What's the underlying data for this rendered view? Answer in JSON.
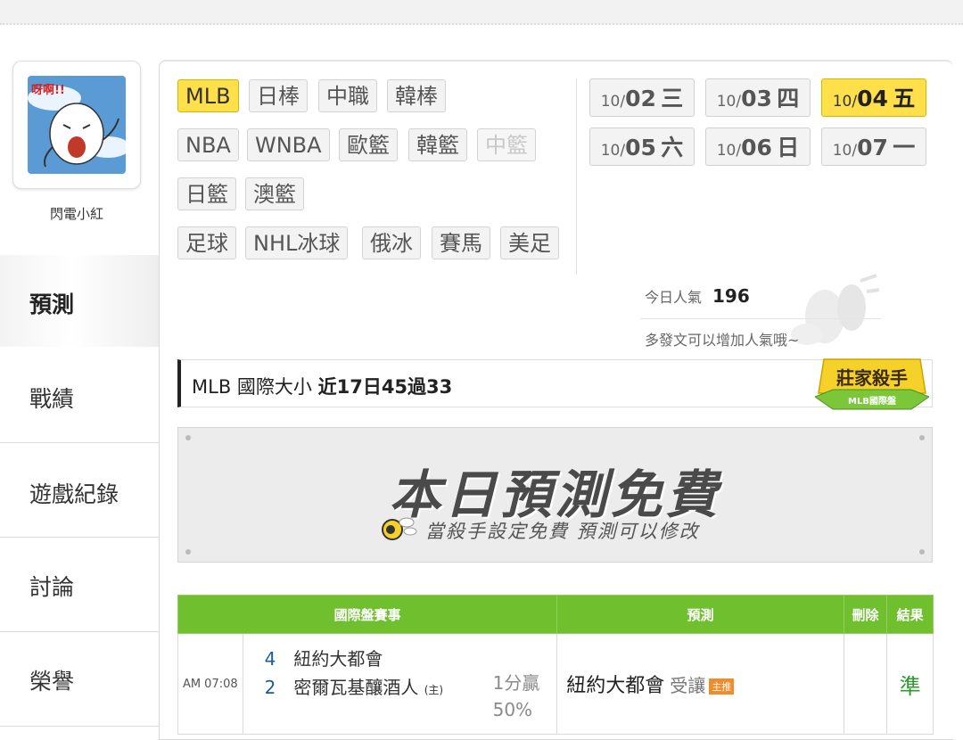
{
  "user": {
    "name": "閃電小紅",
    "avatar_text": "呀啊!!"
  },
  "nav": [
    {
      "label": "預測",
      "active": true
    },
    {
      "label": "戰績"
    },
    {
      "label": "遊戲紀錄"
    },
    {
      "label": "討論"
    },
    {
      "label": "榮譽"
    }
  ],
  "leagues": [
    {
      "label": "MLB",
      "active": true
    },
    {
      "label": "日棒"
    },
    {
      "label": "中職"
    },
    {
      "label": "韓棒"
    },
    {
      "label": "NBA"
    },
    {
      "label": "WNBA"
    },
    {
      "label": "歐籃"
    },
    {
      "label": "韓籃"
    },
    {
      "label": "中籃",
      "disabled": true
    },
    {
      "label": "日籃"
    },
    {
      "label": "澳籃"
    },
    {
      "label": "足球"
    },
    {
      "label": "NHL冰球"
    },
    {
      "label": "俄冰"
    },
    {
      "label": "賽馬"
    },
    {
      "label": "美足"
    }
  ],
  "dates": [
    {
      "month": "10/",
      "day": "02",
      "weekday": "三"
    },
    {
      "month": "10/",
      "day": "03",
      "weekday": "四"
    },
    {
      "month": "10/",
      "day": "04",
      "weekday": "五",
      "active": true
    },
    {
      "month": "10/",
      "day": "05",
      "weekday": "六"
    },
    {
      "month": "10/",
      "day": "06",
      "weekday": "日"
    },
    {
      "month": "10/",
      "day": "07",
      "weekday": "一"
    }
  ],
  "popularity": {
    "label": "今日人氣",
    "value": "196",
    "hint": "多發文可以增加人氣哦~"
  },
  "title": {
    "prefix": "MLB 國際大小",
    "record": "近17日45過33"
  },
  "badge": {
    "main": "莊家殺手",
    "sub": "MLB國際盤"
  },
  "banner": {
    "headline": "本日預測免費",
    "subline": "當殺手設定免費  預測可以修改"
  },
  "table": {
    "headers": {
      "event": "國際盤賽事",
      "prediction": "預測",
      "delete": "刪除",
      "result": "結果"
    },
    "rows": [
      {
        "time": "AM 07:08",
        "away_score": "4",
        "away_team": "紐約大都會",
        "home_score": "2",
        "home_team": "密爾瓦基釀酒人",
        "home_mark": "(主)",
        "odds_line": "1分贏",
        "odds_pct": "50%",
        "pick_team": "紐約大都會",
        "pick_type": "受讓",
        "pick_tag": "主推",
        "result": "準"
      }
    ]
  },
  "colors": {
    "accent_yellow": "#ffe04a",
    "table_header_green": "#6fbf2f",
    "result_green": "#2c9a2c"
  }
}
